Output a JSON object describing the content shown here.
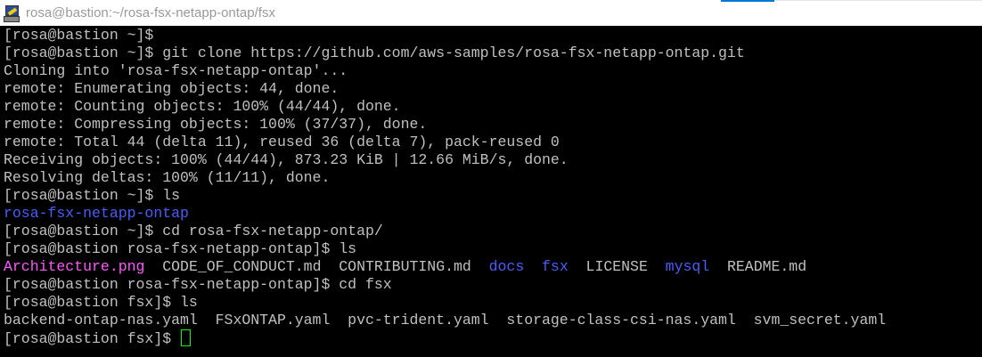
{
  "window": {
    "title": "rosa@bastion:~/rosa-fsx-netapp-ontap/fsx"
  },
  "colors": {
    "text": "#c0c0c0",
    "directory": "#4a5cff",
    "image": "#ff55ff",
    "cursor": "#00ff00"
  },
  "terminal": {
    "lines": [
      [
        {
          "t": "[rosa@bastion ~]$ ",
          "c": "text"
        }
      ],
      [
        {
          "t": "[rosa@bastion ~]$ git clone https://github.com/aws-samples/rosa-fsx-netapp-ontap.git",
          "c": "text"
        }
      ],
      [
        {
          "t": "Cloning into 'rosa-fsx-netapp-ontap'...",
          "c": "text"
        }
      ],
      [
        {
          "t": "remote: Enumerating objects: 44, done.",
          "c": "text"
        }
      ],
      [
        {
          "t": "remote: Counting objects: 100% (44/44), done.",
          "c": "text"
        }
      ],
      [
        {
          "t": "remote: Compressing objects: 100% (37/37), done.",
          "c": "text"
        }
      ],
      [
        {
          "t": "remote: Total 44 (delta 11), reused 36 (delta 7), pack-reused 0",
          "c": "text"
        }
      ],
      [
        {
          "t": "Receiving objects: 100% (44/44), 873.23 KiB | 12.66 MiB/s, done.",
          "c": "text"
        }
      ],
      [
        {
          "t": "Resolving deltas: 100% (11/11), done.",
          "c": "text"
        }
      ],
      [
        {
          "t": "[rosa@bastion ~]$ ls",
          "c": "text"
        }
      ],
      [
        {
          "t": "rosa-fsx-netapp-ontap",
          "c": "directory"
        }
      ],
      [
        {
          "t": "[rosa@bastion ~]$ cd rosa-fsx-netapp-ontap/",
          "c": "text"
        }
      ],
      [
        {
          "t": "[rosa@bastion rosa-fsx-netapp-ontap]$ ls",
          "c": "text"
        }
      ],
      [
        {
          "t": "Architecture.png",
          "c": "image"
        },
        {
          "t": "  CODE_OF_CONDUCT.md  CONTRIBUTING.md  ",
          "c": "text"
        },
        {
          "t": "docs",
          "c": "directory"
        },
        {
          "t": "  ",
          "c": "text"
        },
        {
          "t": "fsx",
          "c": "directory"
        },
        {
          "t": "  LICENSE  ",
          "c": "text"
        },
        {
          "t": "mysql",
          "c": "directory"
        },
        {
          "t": "  README.md",
          "c": "text"
        }
      ],
      [
        {
          "t": "[rosa@bastion rosa-fsx-netapp-ontap]$ cd fsx",
          "c": "text"
        }
      ],
      [
        {
          "t": "[rosa@bastion fsx]$ ls",
          "c": "text"
        }
      ],
      [
        {
          "t": "backend-ontap-nas.yaml  FSxONTAP.yaml  pvc-trident.yaml  storage-class-csi-nas.yaml  svm_secret.yaml",
          "c": "text"
        }
      ],
      [
        {
          "t": "[rosa@bastion fsx]$ ",
          "c": "text"
        }
      ]
    ]
  }
}
